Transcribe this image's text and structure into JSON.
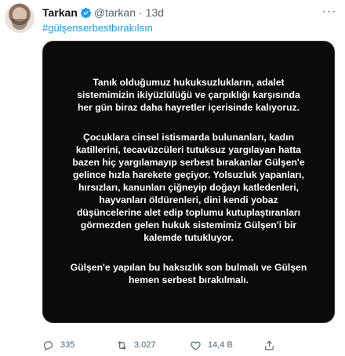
{
  "author": {
    "display_name": "Tarkan",
    "handle": "@tarkan",
    "separator": "·",
    "time": "13d"
  },
  "hashtag": "#gülşenserbestbırakılsın",
  "image_text": {
    "para1": [
      "Tanık olduğumuz hukuksuzlukların, adalet",
      "sistemimizin ikiyüzlülüğü ve çarpıklığı karşısında",
      "her gün biraz daha hayretler içerisinde kalıyoruz."
    ],
    "para2": [
      "Çocuklara cinsel istismarda bulunanları, kadın",
      "katillerini, tecavüzcüleri tutuksuz yargılayan hatta",
      "bazen hiç yargılamayıp serbest bırakanlar Gülşen'e",
      "gelince hızla harekete geçiyor. Yolsuzluk yapanları,",
      "hırsızları, kanunları çiğneyip doğayı katledenleri,",
      "hayvanları öldürenleri, dini kendi yobaz",
      "düşüncelerine alet edip toplumu kutuplaştıranları",
      "görmezden gelen hukuk sistemimiz Gülşen'i bir",
      "kalemde tutukluyor."
    ],
    "para3": [
      "Gülşen'e yapılan bu haksızlık son bulmalı ve Gülşen",
      "hemen serbest bırakılmalı."
    ]
  },
  "actions": {
    "reply_count": "335",
    "retweet_count": "3.027",
    "like_count": "14,4 B"
  },
  "colors": {
    "accent": "#1d9bf0",
    "muted": "#536471",
    "image_bg": "#0b0b0b"
  },
  "icons": [
    "verified-badge-icon",
    "more-icon",
    "reply-icon",
    "retweet-icon",
    "like-icon",
    "share-icon"
  ]
}
